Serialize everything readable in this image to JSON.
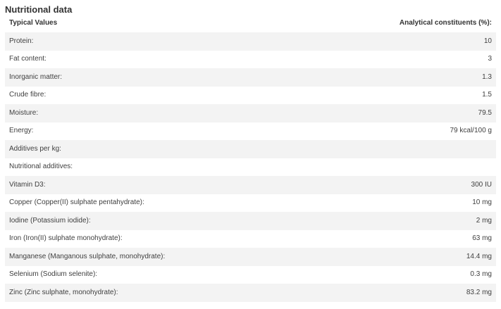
{
  "section": {
    "title": "Nutritional data"
  },
  "table": {
    "headers": {
      "label": "Typical Values",
      "value": "Analytical constituents (%):"
    },
    "rows": [
      {
        "label": "Protein:",
        "value": "10"
      },
      {
        "label": "Fat content:",
        "value": "3"
      },
      {
        "label": "Inorganic matter:",
        "value": "1.3"
      },
      {
        "label": "Crude fibre:",
        "value": "1.5"
      },
      {
        "label": "Moisture:",
        "value": "79.5"
      },
      {
        "label": "Energy:",
        "value": "79 kcal/100 g"
      },
      {
        "label": "Additives per kg:",
        "value": ""
      },
      {
        "label": "Nutritional additives:",
        "value": ""
      },
      {
        "label": "Vitamin D3:",
        "value": "300 IU"
      },
      {
        "label": "Copper (Copper(II) sulphate pentahydrate):",
        "value": "10 mg"
      },
      {
        "label": "Iodine (Potassium iodide):",
        "value": "2 mg"
      },
      {
        "label": "Iron (Iron(II) sulphate monohydrate):",
        "value": "63 mg"
      },
      {
        "label": "Manganese (Manganous sulphate, monohydrate):",
        "value": "14.4 mg"
      },
      {
        "label": "Selenium (Sodium selenite):",
        "value": "0.3 mg"
      },
      {
        "label": "Zinc (Zinc sulphate, monohydrate):",
        "value": "83.2 mg"
      }
    ]
  },
  "colors": {
    "stripe": "#f3f3f3",
    "text": "#3a3a3a"
  }
}
